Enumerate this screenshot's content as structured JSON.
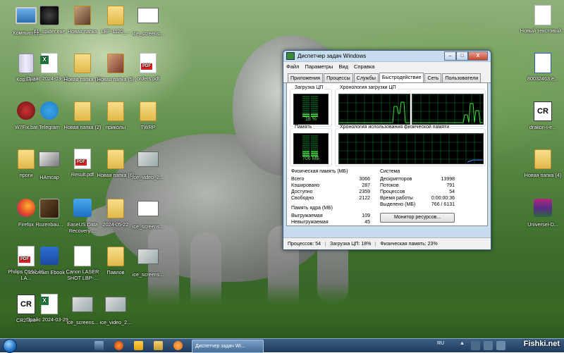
{
  "desktop_icons": [
    {
      "label": "Компьютер",
      "icon": "computer-icon"
    },
    {
      "label": "61_spider.exe",
      "icon": "spider-exe-icon"
    },
    {
      "label": "Новая папка",
      "icon": "image-folder-icon"
    },
    {
      "label": "LBP-1120_...",
      "icon": "folder-icon"
    },
    {
      "label": "ice_screens...",
      "icon": "screenshot-file-icon"
    },
    {
      "label": "Корзина",
      "icon": "recycle-bin-icon"
    },
    {
      "label": "Прайс 2024-03-12...",
      "icon": "excel-file-icon"
    },
    {
      "label": "Новая папка (3)",
      "icon": "folder-icon"
    },
    {
      "label": "Новая папка (5)",
      "icon": "folder-icon"
    },
    {
      "label": "orders.pdf",
      "icon": "pdf-file-icon"
    },
    {
      "label": "W7Fix.bat",
      "icon": "batch-file-icon"
    },
    {
      "label": "Telegram",
      "icon": "telegram-icon"
    },
    {
      "label": "Новая папка (2)",
      "icon": "folder-icon"
    },
    {
      "label": "приколы",
      "icon": "folder-icon"
    },
    {
      "label": "TWRP",
      "icon": "folder-icon"
    },
    {
      "label": "проги",
      "icon": "folder-icon"
    },
    {
      "label": "HAmcap",
      "icon": "hamcap-icon"
    },
    {
      "label": "Result.pdf",
      "icon": "pdf-file-icon"
    },
    {
      "label": "Новая папка (6)",
      "icon": "folder-icon"
    },
    {
      "label": "ice_video_2...",
      "icon": "video-file-icon"
    },
    {
      "label": "Firefox",
      "icon": "firefox-icon"
    },
    {
      "label": "Rozenbau...",
      "icon": "image-file-icon"
    },
    {
      "label": "EaseUS Data Recovery ...",
      "icon": "easeus-icon"
    },
    {
      "label": "2024-05-22",
      "icon": "folder-icon"
    },
    {
      "label": "ice_screens...",
      "icon": "screenshot-file-icon"
    },
    {
      "label": "Philips Q552.4E LA...",
      "icon": "pdf-file-icon"
    },
    {
      "label": "Icecream Ebook ...",
      "icon": "icecream-ebook-icon"
    },
    {
      "label": "Canon LASER SHOT LBP-...",
      "icon": "canon-printer-icon"
    },
    {
      "label": "Павлов",
      "icon": "folder-icon"
    },
    {
      "label": "ice_screens...",
      "icon": "screenshot-file-icon"
    },
    {
      "label": "CR2.exe",
      "icon": "cr2-exe-icon"
    },
    {
      "label": "Прайс 2024-03-29...",
      "icon": "excel-file-icon"
    },
    {
      "label": "ice_screens...",
      "icon": "screenshot-file-icon"
    },
    {
      "label": "ice_video_2...",
      "icon": "video-file-icon"
    },
    {
      "label": "Новый текстовый...",
      "icon": "text-file-icon"
    },
    {
      "label": "80032463.e...",
      "icon": "exe-file-icon"
    },
    {
      "label": "drakon-i-e...",
      "icon": "cr-file-icon"
    },
    {
      "label": "Новая папка (4)",
      "icon": "folder-icon"
    },
    {
      "label": "Universel-D...",
      "icon": "winrar-archive-icon"
    }
  ],
  "task_manager": {
    "title": "Диспетчер задач Windows",
    "menu": [
      "Файл",
      "Параметры",
      "Вид",
      "Справка"
    ],
    "tabs": [
      "Приложения",
      "Процессы",
      "Службы",
      "Быстродействие",
      "Сеть",
      "Пользователи"
    ],
    "active_tab": "Быстродействие",
    "cpu_usage_title": "Загрузка ЦП",
    "cpu_usage_value": "18 %",
    "cpu_usage_fraction": 0.18,
    "cpu_history_title": "Хронология загрузки ЦП",
    "memory_title": "Память",
    "memory_value": "706 МБ",
    "memory_fraction": 0.23,
    "memory_history_title": "Хронология использования физической памяти",
    "physical_memory": {
      "title": "Физическая память (МБ)",
      "rows": [
        {
          "label": "Всего",
          "value": "3066"
        },
        {
          "label": "Кэшировано",
          "value": "287"
        },
        {
          "label": "Доступно",
          "value": "2359"
        },
        {
          "label": "Свободно",
          "value": "2122"
        }
      ]
    },
    "kernel_memory": {
      "title": "Память ядра (МБ)",
      "rows": [
        {
          "label": "Выгружаемая",
          "value": "109"
        },
        {
          "label": "Невыгружаемая",
          "value": "45"
        }
      ]
    },
    "system": {
      "title": "Система",
      "rows": [
        {
          "label": "Дескрипторов",
          "value": "13998"
        },
        {
          "label": "Потоков",
          "value": "791"
        },
        {
          "label": "Процессов",
          "value": "54"
        },
        {
          "label": "Время работы",
          "value": "0:00:00:36"
        },
        {
          "label": "Выделено (МБ)",
          "value": "766 / 6131"
        }
      ]
    },
    "resource_monitor_button": "Монитор ресурсов...",
    "status": {
      "processes": "Процессов: 54",
      "cpu": "Загрузка ЦП: 18%",
      "memory": "Физическая память: 23%"
    },
    "window_buttons": {
      "minimize": "–",
      "maximize": "□",
      "close": "X"
    }
  },
  "taskbar": {
    "task_label": "Диспетчер задач Wi...",
    "language": "RU",
    "watermark": "Fishki.net"
  },
  "colors": {
    "graph_green": "#3fe03f",
    "graph_grid": "#0a6a2a",
    "memory_line": "#3f7fff"
  }
}
